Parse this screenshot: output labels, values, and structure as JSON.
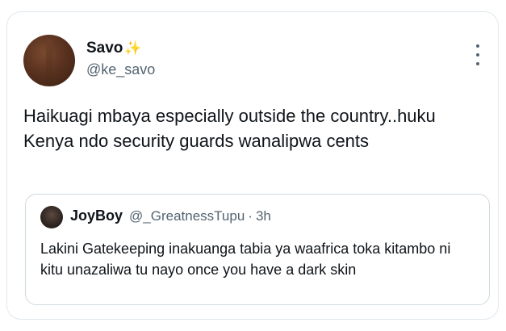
{
  "tweet": {
    "display_name": "Savo",
    "handle": "@ke_savo",
    "text": "Haikuagi mbaya especially outside the country..huku Kenya ndo security guards wanalipwa cents"
  },
  "quoted_tweet": {
    "display_name": "JoyBoy",
    "handle": "@_GreatnessTupu",
    "separator": "·",
    "time": "3h",
    "text": "Lakini Gatekeeping inakuanga tabia ya waafrica toka kitambo ni kitu unazaliwa tu nayo once you have a dark skin"
  },
  "icons": {
    "name_badge": "sparkles-icon",
    "menu": "more-options-icon"
  },
  "colors": {
    "primary_text": "#0f1419",
    "secondary_text": "#536471",
    "border": "#cfd9de",
    "sparkle": "#f5b301"
  }
}
